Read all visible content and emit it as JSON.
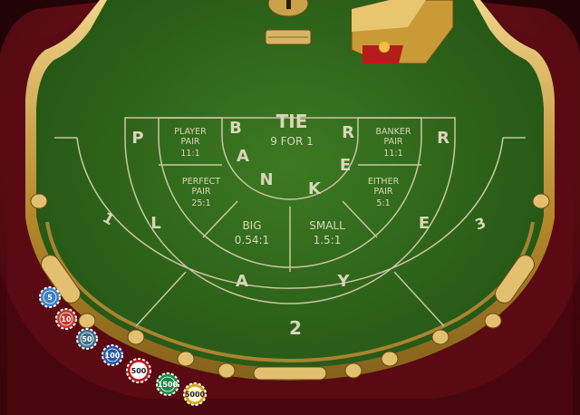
{
  "table": {
    "tie": {
      "title": "TIE",
      "payout": "9 FOR 1"
    },
    "banker_word": [
      "B",
      "A",
      "N",
      "K",
      "E",
      "R"
    ],
    "player_word": [
      "P",
      "L",
      "A",
      "Y",
      "E",
      "R"
    ],
    "player_pair": {
      "line1": "PLAYER",
      "line2": "PAIR",
      "payout": "11:1"
    },
    "banker_pair": {
      "line1": "BANKER",
      "line2": "PAIR",
      "payout": "11:1"
    },
    "perfect_pair": {
      "line1": "PERFECT",
      "line2": "PAIR",
      "payout": "25:1"
    },
    "either_pair": {
      "line1": "EITHER",
      "line2": "PAIR",
      "payout": "5:1"
    },
    "big": {
      "label": "BIG",
      "payout": "0.54:1"
    },
    "small": {
      "label": "SMALL",
      "payout": "1.5:1"
    },
    "seats": [
      "1",
      "2",
      "3"
    ]
  },
  "chips": [
    {
      "value": "5",
      "color": "#3f7fbf"
    },
    {
      "value": "10",
      "color": "#c0392b"
    },
    {
      "value": "50",
      "color": "#3a6d8c"
    },
    {
      "value": "100",
      "color": "#2656a8"
    },
    {
      "value": "500",
      "color": "#b51d1d"
    },
    {
      "value": "1500",
      "color": "#1e8a4a"
    },
    {
      "value": "5000",
      "color": "#d4a516"
    }
  ],
  "colors": {
    "felt": "#2f6a1c",
    "rail": "#6a0d16",
    "gold": "#c9a24a",
    "line": "#c9c7a2"
  }
}
